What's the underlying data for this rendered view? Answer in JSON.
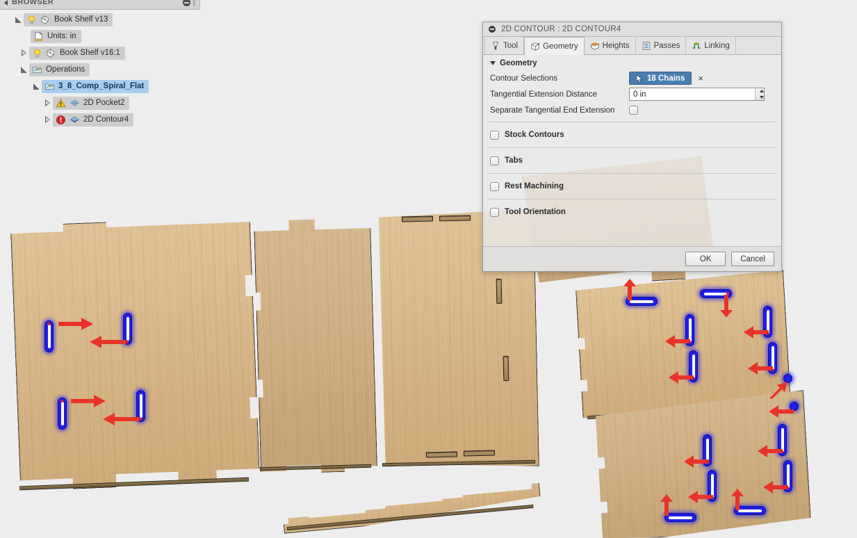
{
  "browser": {
    "title": "BROWSER",
    "collapse_icon": "minus-circle-icon",
    "back_icon": "triangle-left-icon",
    "tree": [
      {
        "indent": 0,
        "expander": "open",
        "icon": "lightbulb-and-body-icon",
        "label": "Book Shelf v13",
        "selected": false
      },
      {
        "indent": 1,
        "expander": "none",
        "icon": "document-ruler-icon",
        "label": "Units: in",
        "selected": false
      },
      {
        "indent": 1,
        "expander": "closed",
        "icon": "lightbulb-and-body-icon",
        "label": "Book Shelf v16:1",
        "selected": false
      },
      {
        "indent": 1,
        "expander": "open",
        "icon": "setup-folder-icon",
        "label": "Operations",
        "selected": false
      },
      {
        "indent": 2,
        "expander": "open",
        "icon": "setup-folder-icon",
        "label": "3_8_Comp_Spiral_Flat",
        "selected": true
      },
      {
        "indent": 3,
        "expander": "closed",
        "icon": "warning-triangle-icon",
        "label": "2D Pocket2",
        "selected": false,
        "op_icon": "2d-pocket-icon"
      },
      {
        "indent": 3,
        "expander": "closed",
        "icon": "error-circle-icon",
        "label": "2D Contour4",
        "selected": false,
        "op_icon": "2d-contour-icon"
      }
    ]
  },
  "dialog": {
    "title": "2D CONTOUR : 2D CONTOUR4",
    "collapse_icon": "minus-circle-icon",
    "tabs": [
      {
        "label": "Tool",
        "icon": "tool-icon",
        "active": false
      },
      {
        "label": "Geometry",
        "icon": "geometry-icon",
        "active": true
      },
      {
        "label": "Heights",
        "icon": "heights-icon",
        "active": false
      },
      {
        "label": "Passes",
        "icon": "passes-icon",
        "active": false
      },
      {
        "label": "Linking",
        "icon": "linking-icon",
        "active": false
      }
    ],
    "geometry": {
      "section_label": "Geometry",
      "contour_selections_label": "Contour Selections",
      "contour_selections_value": "18 Chains",
      "contour_selections_icon": "cursor-arrow-icon",
      "clear_label": "×",
      "tangential_extension_label": "Tangential Extension Distance",
      "tangential_extension_value": "0 in",
      "separate_tangential_label": "Separate Tangential End Extension",
      "separate_tangential_checked": false
    },
    "collapsed_sections": [
      {
        "label": "Stock Contours",
        "checked": false
      },
      {
        "label": "Tabs",
        "checked": false
      },
      {
        "label": "Rest Machining",
        "checked": false
      },
      {
        "label": "Tool Orientation",
        "checked": false
      }
    ],
    "footer": {
      "ok_label": "OK",
      "cancel_label": "Cancel"
    }
  },
  "colors": {
    "selection_blue": "#a8cdf0",
    "chains_button": "#4a7cb0",
    "chain_highlight": "#1f1fe0",
    "arrow_red": "#e8332a",
    "wood_light": "#dcc094",
    "wood_dark": "#c9a878",
    "viewport_background": "#ededed",
    "warning_yellow": "#f5c518",
    "error_red": "#d8232a"
  },
  "viewport": {
    "name": "3d-viewport",
    "panels": [
      {
        "name": "panel-left-large",
        "slots": 4
      },
      {
        "name": "panel-mid-left",
        "slots": 0
      },
      {
        "name": "panel-mid-right",
        "slots": 0
      },
      {
        "name": "panel-right-upper",
        "slots": 7
      },
      {
        "name": "panel-right-lower",
        "slots": 7
      },
      {
        "name": "panel-bottom-strip",
        "slots": 0
      },
      {
        "name": "panel-back-partial",
        "slots": 0
      }
    ],
    "total_highlighted_chains": "18 Chains"
  }
}
